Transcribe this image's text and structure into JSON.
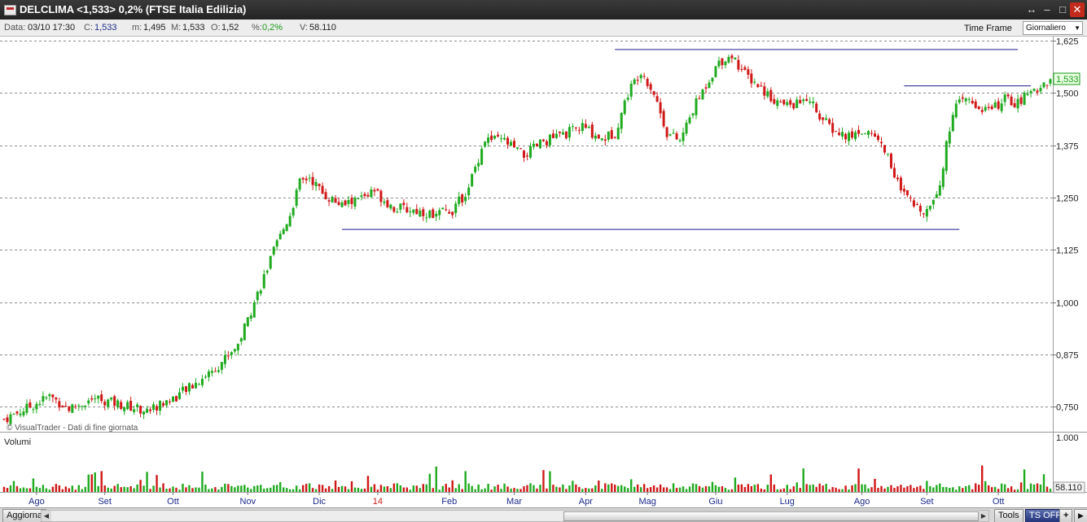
{
  "titlebar": {
    "title": "DELCLIMA <1,533> 0,2%  (FTSE Italia Edilizia)",
    "icons": [
      "app-icon",
      "pin-icon",
      "minimize-icon",
      "maximize-icon",
      "close-icon"
    ]
  },
  "infobar": {
    "data_label": "Data:",
    "data_value": "03/10 17:30",
    "close_label": "C:",
    "close_value": "1,533",
    "min_label": "m:",
    "min_value": "1,495",
    "max_label": "M:",
    "max_value": "1,533",
    "open_label": "O:",
    "open_value": "1,52",
    "pct_label": "%:",
    "pct_value": "0,2%",
    "vol_label": "V:",
    "vol_value": "58.110",
    "timeframe_label": "Time Frame",
    "timeframe_value": "Giornaliero"
  },
  "chart_data": {
    "type": "candlestick",
    "watermark": "© VisualTrader - Dati di fine giornata",
    "price_axis_ticks": [
      "1,625",
      "1,500",
      "1,375",
      "1,250",
      "1,125",
      "1,000",
      "0,875",
      "0,750"
    ],
    "price_tick_values": [
      1.625,
      1.5,
      1.375,
      1.25,
      1.125,
      1.0,
      0.875,
      0.75
    ],
    "ylim": [
      0.69,
      1.635
    ],
    "last_price_label": "1,533",
    "last_price": 1.533,
    "volume_label": "Volumi",
    "volume_top_tick": "1.000",
    "volume_last_label": "58.110",
    "x_axis_labels": [
      "Ago",
      "Set",
      "Ott",
      "Nov",
      "Dic",
      "14",
      "Feb",
      "Mar",
      "Apr",
      "Mag",
      "Giu",
      "Lug",
      "Ago",
      "Set",
      "Ott"
    ],
    "x_axis_label_colors": [
      "#1a2a8a",
      "#1a2a8a",
      "#1a2a8a",
      "#1a2a8a",
      "#1a2a8a",
      "#cc1a1a",
      "#1a2a8a",
      "#1a2a8a",
      "#1a2a8a",
      "#1a2a8a",
      "#1a2a8a",
      "#1a2a8a",
      "#1a2a8a",
      "#1a2a8a",
      "#1a2a8a"
    ],
    "close_path_points": [
      [
        0,
        0.72
      ],
      [
        8,
        0.75
      ],
      [
        14,
        0.775
      ],
      [
        20,
        0.745
      ],
      [
        28,
        0.77
      ],
      [
        36,
        0.755
      ],
      [
        44,
        0.74
      ],
      [
        52,
        0.77
      ],
      [
        58,
        0.8
      ],
      [
        66,
        0.85
      ],
      [
        72,
        0.9
      ],
      [
        76,
        0.98
      ],
      [
        80,
        1.06
      ],
      [
        84,
        1.14
      ],
      [
        88,
        1.21
      ],
      [
        91,
        1.285
      ],
      [
        94,
        1.3
      ],
      [
        98,
        1.26
      ],
      [
        104,
        1.23
      ],
      [
        110,
        1.25
      ],
      [
        114,
        1.265
      ],
      [
        120,
        1.225
      ],
      [
        126,
        1.22
      ],
      [
        132,
        1.21
      ],
      [
        138,
        1.22
      ],
      [
        142,
        1.26
      ],
      [
        144,
        1.3
      ],
      [
        148,
        1.39
      ],
      [
        154,
        1.385
      ],
      [
        160,
        1.35
      ],
      [
        166,
        1.385
      ],
      [
        172,
        1.4
      ],
      [
        178,
        1.42
      ],
      [
        184,
        1.39
      ],
      [
        188,
        1.405
      ],
      [
        192,
        1.5
      ],
      [
        196,
        1.555
      ],
      [
        200,
        1.5
      ],
      [
        204,
        1.405
      ],
      [
        208,
        1.385
      ],
      [
        212,
        1.46
      ],
      [
        216,
        1.52
      ],
      [
        220,
        1.575
      ],
      [
        224,
        1.59
      ],
      [
        228,
        1.545
      ],
      [
        232,
        1.52
      ],
      [
        236,
        1.49
      ],
      [
        240,
        1.47
      ],
      [
        244,
        1.475
      ],
      [
        248,
        1.485
      ],
      [
        252,
        1.435
      ],
      [
        256,
        1.405
      ],
      [
        260,
        1.395
      ],
      [
        264,
        1.41
      ],
      [
        268,
        1.4
      ],
      [
        272,
        1.35
      ],
      [
        276,
        1.265
      ],
      [
        280,
        1.23
      ],
      [
        284,
        1.22
      ],
      [
        288,
        1.285
      ],
      [
        292,
        1.46
      ],
      [
        296,
        1.485
      ],
      [
        300,
        1.465
      ],
      [
        304,
        1.46
      ],
      [
        308,
        1.485
      ],
      [
        312,
        1.475
      ],
      [
        316,
        1.505
      ],
      [
        320,
        1.52
      ],
      [
        322,
        1.533
      ]
    ],
    "support_resistance_lines": [
      {
        "x1": 104,
        "x2": 294,
        "y": 1.175
      },
      {
        "x1": 188,
        "x2": 312,
        "y": 1.605
      },
      {
        "x1": 277,
        "x2": 316,
        "y": 1.518
      }
    ],
    "bar_count": 323,
    "volume_ticks": [
      1.0
    ],
    "volume_max": 1.0,
    "volume_last": 0.058,
    "month_start_bars": [
      10,
      31,
      52,
      75,
      97,
      115,
      137,
      157,
      179,
      198,
      219,
      241,
      264,
      284,
      306
    ],
    "colors": {
      "up": "#1faa1f",
      "down": "#d01818",
      "grid": "#8a8a8a",
      "trend_line": "#1a1a8c",
      "label_highlight": "#1a9a1a",
      "label_bg": "#e9ffe2"
    }
  },
  "bottombar": {
    "aggiorna_label": "Aggiorna",
    "tools_label": "Tools",
    "tsoff_label": "TS OFF",
    "plus_label": "+",
    "scroll_left_glyph": "◀",
    "scroll_right_glyph": "▶"
  }
}
